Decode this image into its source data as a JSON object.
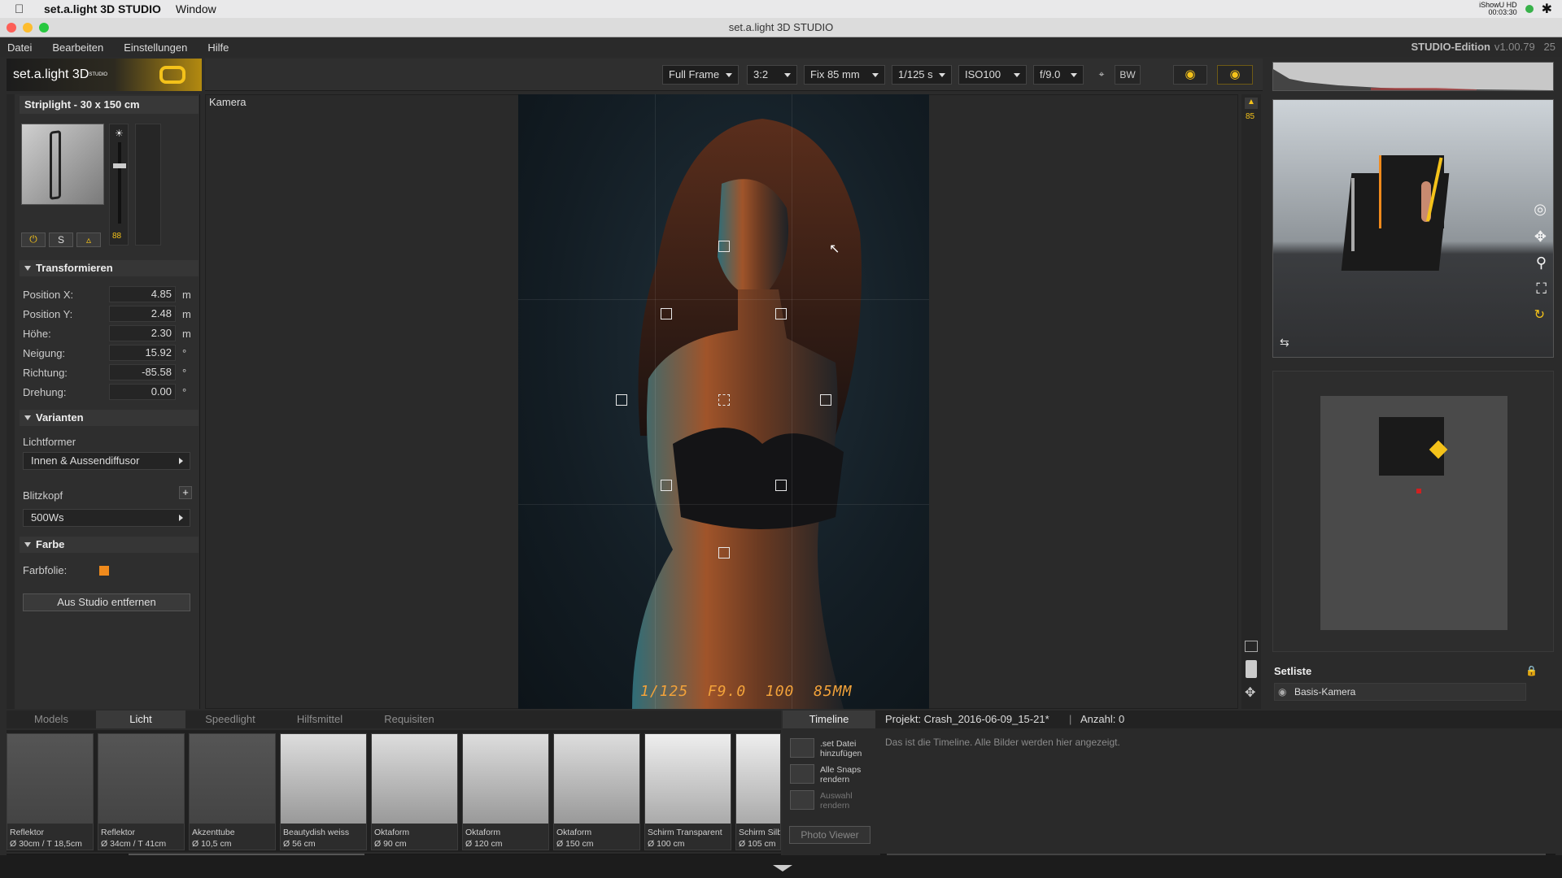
{
  "macos": {
    "app_name": "set.a.light 3D STUDIO",
    "menu_window": "Window",
    "status_text": "iShowU HD",
    "status_time": "00:03:30"
  },
  "window_title": "set.a.light 3D STUDIO",
  "menu": {
    "items": [
      "Datei",
      "Bearbeiten",
      "Einstellungen",
      "Hilfe"
    ],
    "edition": "STUDIO-Edition",
    "version": "v1.00.79",
    "version_suffix": "25"
  },
  "logo_text": "set.a.light 3D",
  "logo_super": "STUDIO",
  "toolbar": {
    "format": "Full Frame",
    "ratio": "3:2",
    "lens": "Fix 85 mm",
    "shutter": "1/125 s",
    "iso": "ISO100",
    "aperture": "f/9.0",
    "bw": "BW"
  },
  "light": {
    "title": "Striplight - 30 x 150 cm",
    "power_value": "88",
    "btn_s": "S"
  },
  "transform": {
    "header": "Transformieren",
    "rows": [
      {
        "label": "Position X:",
        "value": "4.85",
        "unit": "m"
      },
      {
        "label": "Position Y:",
        "value": "2.48",
        "unit": "m"
      },
      {
        "label": "Höhe:",
        "value": "2.30",
        "unit": "m"
      },
      {
        "label": "Neigung:",
        "value": "15.92",
        "unit": "°"
      },
      {
        "label": "Richtung:",
        "value": "-85.58",
        "unit": "°"
      },
      {
        "label": "Drehung:",
        "value": "0.00",
        "unit": "°"
      }
    ]
  },
  "variants": {
    "header": "Varianten",
    "lightformer_label": "Lichtformer",
    "lightformer_value": "Innen & Aussendiffusor",
    "flash_label": "Blitzkopf",
    "flash_value": "500Ws"
  },
  "color": {
    "header": "Farbe",
    "filter_label": "Farbfolie:",
    "filter_color": "#f08a1c"
  },
  "remove_button": "Aus Studio entfernen",
  "viewport": {
    "label": "Kamera",
    "exif_overlay": "1/125  F9.0  100  85MM",
    "focal_badge": "85"
  },
  "setlist": {
    "title": "Setliste",
    "item": "Basis-Kamera"
  },
  "bottom_tabs": [
    "Models",
    "Licht",
    "Speedlight",
    "Hilfsmittel",
    "Requisiten"
  ],
  "library": [
    {
      "name": "Reflektor",
      "dims": "Ø 30cm / T 18,5cm"
    },
    {
      "name": "Reflektor",
      "dims": "Ø 34cm / T 41cm"
    },
    {
      "name": "Akzenttube",
      "dims": "Ø 10,5 cm"
    },
    {
      "name": "Beautydish weiss",
      "dims": "Ø 56 cm"
    },
    {
      "name": "Oktaform",
      "dims": "Ø 90 cm"
    },
    {
      "name": "Oktaform",
      "dims": "Ø 120 cm"
    },
    {
      "name": "Oktaform",
      "dims": "Ø 150 cm"
    },
    {
      "name": "Schirm Transparent",
      "dims": "Ø 100 cm"
    },
    {
      "name": "Schirm Silb",
      "dims": "Ø 105 cm"
    }
  ],
  "timeline": {
    "tab": "Timeline",
    "project": "Projekt: Crash_2016-06-09_15-21*",
    "count": "Anzahl: 0",
    "empty_text": "Das ist die Timeline. Alle Bilder werden hier angezeigt.",
    "btn_add": ".set Datei hinzufügen",
    "btn_render_all": "Alle Snaps rendern",
    "btn_render_sel": "Auswahl rendern",
    "btn_viewer": "Photo Viewer"
  },
  "colors": {
    "accent": "#f4c21a",
    "orange": "#f08a1c"
  }
}
